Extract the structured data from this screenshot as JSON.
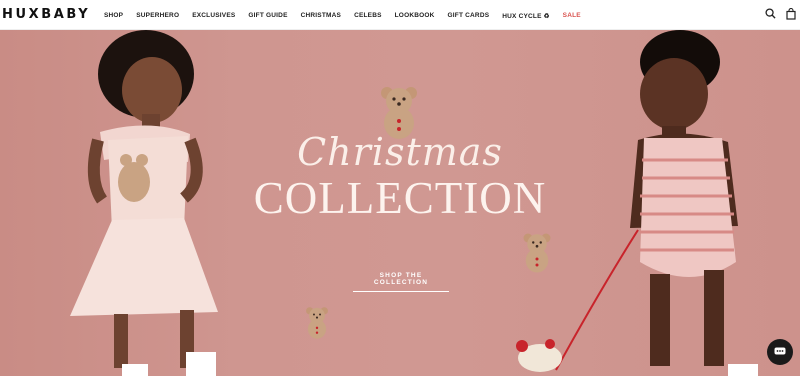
{
  "header": {
    "logo": "HUXBABY",
    "nav": [
      {
        "label": "SHOP"
      },
      {
        "label": "SUPERHERO"
      },
      {
        "label": "EXCLUSIVES"
      },
      {
        "label": "GIFT GUIDE"
      },
      {
        "label": "CHRISTMAS"
      },
      {
        "label": "CELEBS"
      },
      {
        "label": "LOOKBOOK"
      },
      {
        "label": "GIFT CARDS"
      },
      {
        "label": "HUX CYCLE ♻"
      },
      {
        "label": "SALE"
      }
    ],
    "icons": [
      "search-icon",
      "cart-icon"
    ]
  },
  "hero": {
    "script_title": "Christmas",
    "title": "COLLECTION",
    "cta_label": "SHOP THE COLLECTION",
    "background_color": "#cf9690"
  },
  "colors": {
    "sale": "#d9534f",
    "chat_button": "#1a1a1a"
  }
}
